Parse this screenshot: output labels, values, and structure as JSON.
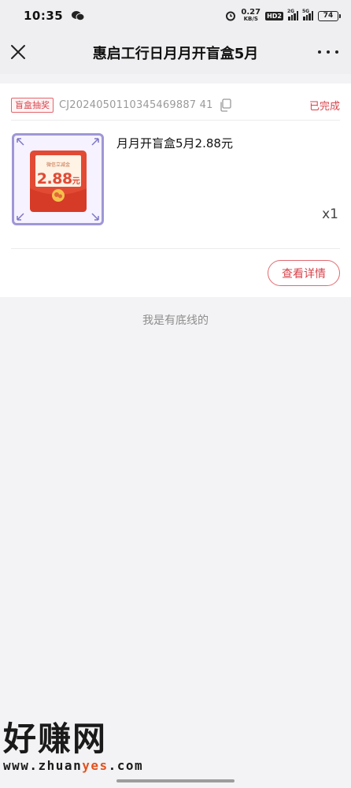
{
  "status_bar": {
    "time": "10:35",
    "net_speed": "0.27",
    "net_unit": "KB/S",
    "hd": "HD2",
    "sim1": "2G",
    "sim2": "5G",
    "battery": "74"
  },
  "header": {
    "title": "惠启工行日月月开盲盒5月",
    "close_icon": "close-icon",
    "more_icon": "more-dots-icon"
  },
  "order": {
    "tag": "盲盒抽奖",
    "order_no": "CJ2024050110345469887 41",
    "status": "已完成",
    "product": {
      "name": "月月开盲盒5月2.88元",
      "image_label": "微信立减金",
      "image_amount": "2.88",
      "image_unit": "元",
      "quantity": "x1"
    },
    "detail_button": "查看详情"
  },
  "footer_note": "我是有底线的",
  "watermark": {
    "big": "好赚网",
    "small_a": "www.zhuan",
    "small_b": "yes",
    "small_c": ".com"
  },
  "colors": {
    "accent": "#d8434b",
    "thumb_border": "#9e97d6",
    "envelope_red": "#e04b35"
  }
}
